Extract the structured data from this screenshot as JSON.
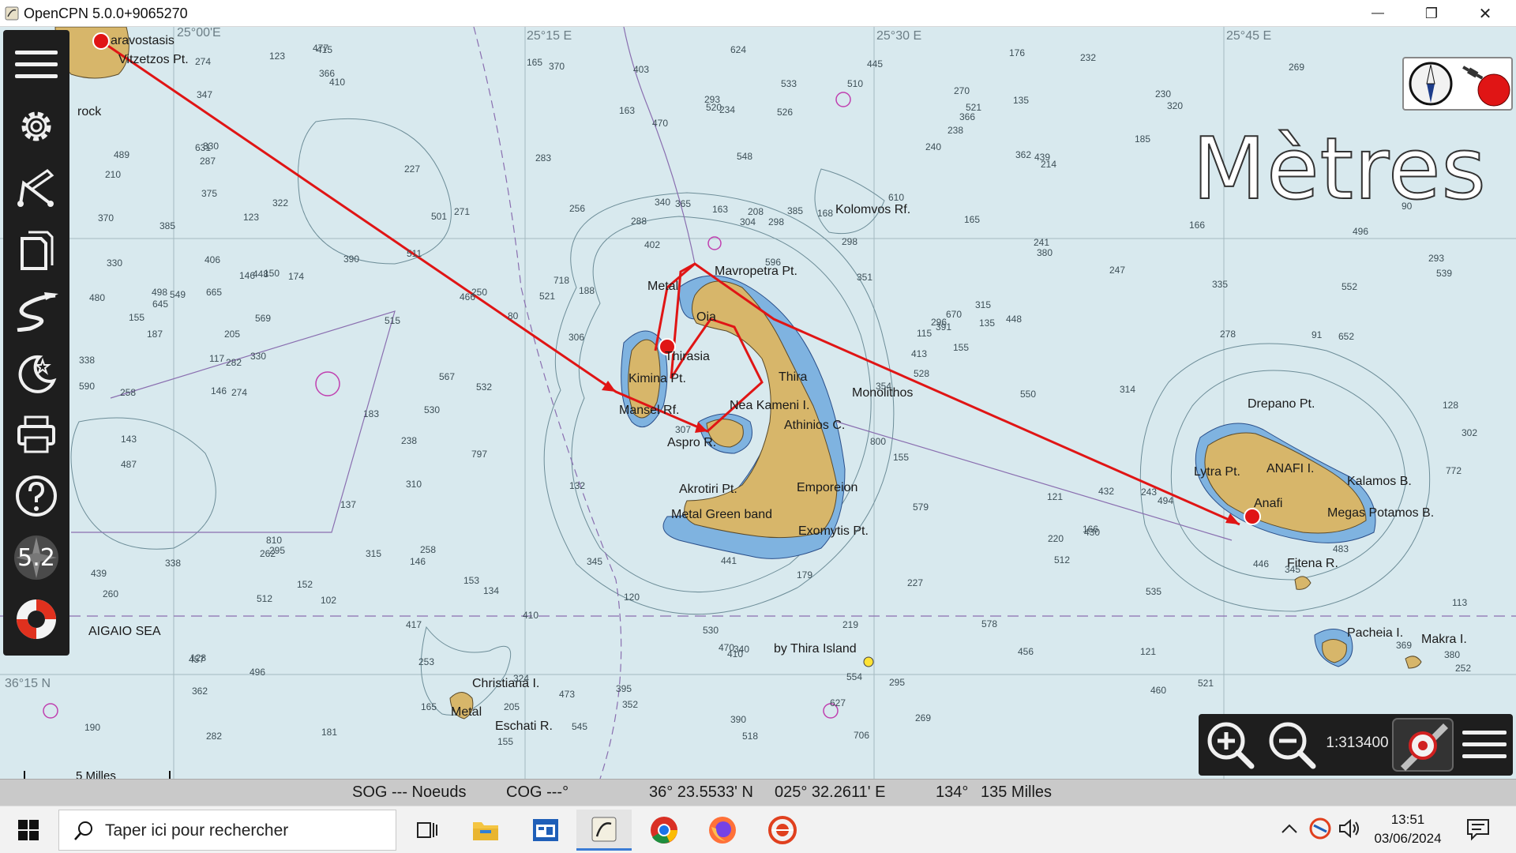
{
  "window": {
    "title": "OpenCPN 5.0.0+9065270",
    "minimize_glyph": "—",
    "maximize_glyph": "❐",
    "close_glyph": "✕"
  },
  "chart": {
    "units_label": "Mètres",
    "longitude_labels": [
      "25°00'E",
      "25°15 E",
      "25°30 E",
      "25°45 E"
    ],
    "latitude_label": "36°15 N",
    "place_names": [
      "aravostasis",
      "Vitzetzos Pt.",
      "rock",
      "Kolomvos Rf.",
      "Mavropetra Pt.",
      "Metal",
      "Oia",
      "Thirasia",
      "Kimina Pt.",
      "Mansel Rf.",
      "Thira",
      "Nea Kameni I.",
      "Athinios C.",
      "Monolithos",
      "Aspro R.",
      "Akrotiri Pt.",
      "Metal Green band",
      "Emporeion",
      "Exomytis Pt.",
      "by Thira Island",
      "AIGAIO SEA",
      "Christiana I.",
      "Metal",
      "Eschati R.",
      "Drepano Pt.",
      "Lytra Pt.",
      "ANAFI I.",
      "Kalamos B.",
      "Anafi",
      "Megas Potamos B.",
      "Fitena R.",
      "Pacheia I.",
      "Makra I."
    ],
    "soundings": [
      "123",
      "128",
      "115",
      "134",
      "135",
      "385",
      "439",
      "354",
      "410",
      "330",
      "307",
      "241",
      "181",
      "163",
      "351",
      "152",
      "188",
      "362",
      "253",
      "208",
      "391",
      "494",
      "322",
      "234",
      "187",
      "121",
      "539",
      "530",
      "271",
      "185",
      "153",
      "369",
      "243",
      "445",
      "521",
      "515",
      "512",
      "480",
      "413",
      "282",
      "410",
      "528",
      "512",
      "496",
      "489",
      "430",
      "456",
      "417",
      "366",
      "274",
      "219",
      "533",
      "532",
      "549",
      "511",
      "477",
      "521",
      "470",
      "439",
      "441",
      "473",
      "432",
      "466",
      "457",
      "347",
      "390",
      "487",
      "554",
      "496",
      "550",
      "390",
      "652",
      "521",
      "706",
      "578",
      "293",
      "302",
      "448",
      "535",
      "483",
      "645",
      "518",
      "362",
      "214",
      "183",
      "165",
      "128",
      "155",
      "137",
      "146",
      "324",
      "296",
      "306",
      "287",
      "298",
      "370",
      "338",
      "340",
      "403",
      "262",
      "269",
      "298",
      "256",
      "314",
      "310",
      "352",
      "278",
      "375",
      "295",
      "269",
      "250",
      "283",
      "797",
      "810",
      "772",
      "718",
      "800",
      "569",
      "446",
      "670",
      "330",
      "395",
      "460",
      "470",
      "520",
      "552",
      "501",
      "498",
      "545",
      "510",
      "548",
      "596",
      "530",
      "610",
      "579",
      "526",
      "590",
      "624",
      "366",
      "406",
      "380",
      "415",
      "345",
      "295",
      "330",
      "270",
      "315",
      "205",
      "240",
      "220",
      "370",
      "448",
      "385",
      "627",
      "665",
      "631",
      "174",
      "146",
      "205",
      "410",
      "345",
      "304",
      "166",
      "155",
      "340",
      "274",
      "365",
      "315",
      "282",
      "230",
      "402",
      "338",
      "247",
      "258",
      "260",
      "320",
      "113",
      "90",
      "80",
      "91",
      "120",
      "102",
      "155",
      "132",
      "117",
      "163",
      "168",
      "190",
      "165",
      "165",
      "258",
      "135",
      "123",
      "121",
      "176",
      "210",
      "155",
      "238",
      "238",
      "567",
      "146",
      "143",
      "166",
      "293",
      "232",
      "150",
      "179",
      "227",
      "252",
      "227",
      "380",
      "335",
      "288"
    ],
    "route_color": "#e01515",
    "land_color": "#d7b66a",
    "shallow_color": "#7fb3e0"
  },
  "left_toolbar": {
    "menu_icon": "hamburger-icon",
    "settings_icon": "gear-icon",
    "route_icon": "route-edit-icon",
    "layers_icon": "page-copy-icon",
    "tracks_icon": "track-icon",
    "night_icon": "moon-star-icon",
    "print_icon": "printer-icon",
    "help_icon": "help-icon",
    "version_label": "5.2",
    "mob_icon": "lifebuoy-icon"
  },
  "scalebar": {
    "label": "5 Milles"
  },
  "progress": {
    "fraction": 0.6
  },
  "bottom_toolbar": {
    "zoom_in_icon": "zoom-in-icon",
    "zoom_out_icon": "zoom-out-icon",
    "scale": "1:313400",
    "route_button_icon": "route-target-icon",
    "menu_icon": "hamburger-icon"
  },
  "status": {
    "sog": "SOG --- Noeuds",
    "cog": "COG ---°",
    "lat": "36° 23.5533' N",
    "lon": "025° 32.2611' E",
    "bearing": "134°",
    "distance": "135 Milles"
  },
  "taskbar": {
    "search_placeholder": "Taper ici pour rechercher",
    "apps": [
      "task-view-icon",
      "file-explorer-icon",
      "control-panel-icon",
      "opencpn-icon",
      "chrome-icon",
      "firefox-icon",
      "security-app-icon"
    ],
    "time": "13:51",
    "date": "03/06/2024"
  }
}
